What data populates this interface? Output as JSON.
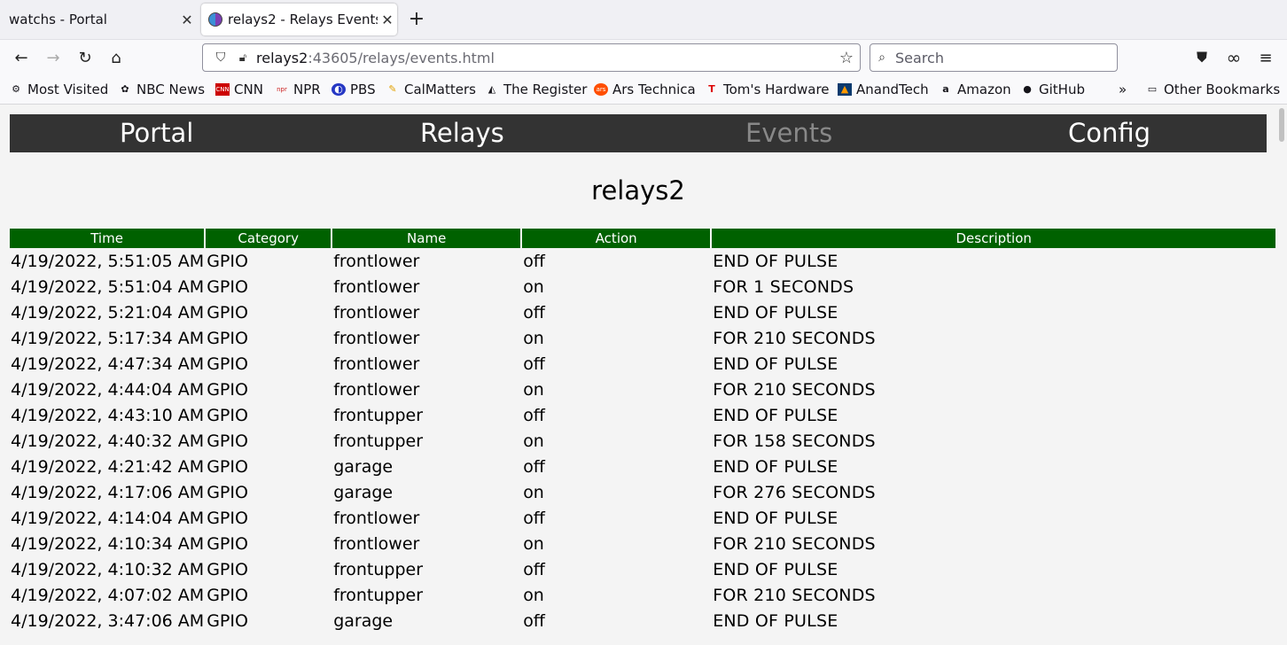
{
  "browser": {
    "tabs": [
      {
        "title": "watchs - Portal",
        "active": false
      },
      {
        "title": "relays2 - Relays Events",
        "active": true
      }
    ],
    "url_host": "relays2",
    "url_rest": ":43605/relays/events.html",
    "search_placeholder": "Search",
    "bookmarks": [
      {
        "label": "Most Visited",
        "icon": "gear-icon"
      },
      {
        "label": "NBC News",
        "icon": "nbc-peacock-icon"
      },
      {
        "label": "CNN",
        "icon": "cnn-icon"
      },
      {
        "label": "NPR",
        "icon": "npr-icon"
      },
      {
        "label": "PBS",
        "icon": "pbs-icon"
      },
      {
        "label": "CalMatters",
        "icon": "calmatters-icon"
      },
      {
        "label": "The Register",
        "icon": "register-icon"
      },
      {
        "label": "Ars Technica",
        "icon": "ars-icon"
      },
      {
        "label": "Tom's Hardware",
        "icon": "toms-hardware-icon"
      },
      {
        "label": "AnandTech",
        "icon": "anandtech-icon"
      },
      {
        "label": "Amazon",
        "icon": "amazon-icon"
      },
      {
        "label": "GitHub",
        "icon": "github-icon"
      }
    ],
    "other_bookmarks": "Other Bookmarks"
  },
  "nav": [
    "Portal",
    "Relays",
    "Events",
    "Config"
  ],
  "current_nav": "Events",
  "page_title": "relays2",
  "table": {
    "headers": [
      "Time",
      "Category",
      "Name",
      "Action",
      "Description"
    ],
    "rows": [
      [
        "4/19/2022, 5:51:05 AM",
        "GPIO",
        "frontlower",
        "off",
        "END OF PULSE"
      ],
      [
        "4/19/2022, 5:51:04 AM",
        "GPIO",
        "frontlower",
        "on",
        "FOR 1 SECONDS"
      ],
      [
        "4/19/2022, 5:21:04 AM",
        "GPIO",
        "frontlower",
        "off",
        "END OF PULSE"
      ],
      [
        "4/19/2022, 5:17:34 AM",
        "GPIO",
        "frontlower",
        "on",
        "FOR 210 SECONDS"
      ],
      [
        "4/19/2022, 4:47:34 AM",
        "GPIO",
        "frontlower",
        "off",
        "END OF PULSE"
      ],
      [
        "4/19/2022, 4:44:04 AM",
        "GPIO",
        "frontlower",
        "on",
        "FOR 210 SECONDS"
      ],
      [
        "4/19/2022, 4:43:10 AM",
        "GPIO",
        "frontupper",
        "off",
        "END OF PULSE"
      ],
      [
        "4/19/2022, 4:40:32 AM",
        "GPIO",
        "frontupper",
        "on",
        "FOR 158 SECONDS"
      ],
      [
        "4/19/2022, 4:21:42 AM",
        "GPIO",
        "garage",
        "off",
        "END OF PULSE"
      ],
      [
        "4/19/2022, 4:17:06 AM",
        "GPIO",
        "garage",
        "on",
        "FOR 276 SECONDS"
      ],
      [
        "4/19/2022, 4:14:04 AM",
        "GPIO",
        "frontlower",
        "off",
        "END OF PULSE"
      ],
      [
        "4/19/2022, 4:10:34 AM",
        "GPIO",
        "frontlower",
        "on",
        "FOR 210 SECONDS"
      ],
      [
        "4/19/2022, 4:10:32 AM",
        "GPIO",
        "frontupper",
        "off",
        "END OF PULSE"
      ],
      [
        "4/19/2022, 4:07:02 AM",
        "GPIO",
        "frontupper",
        "on",
        "FOR 210 SECONDS"
      ],
      [
        "4/19/2022, 3:47:06 AM",
        "GPIO",
        "garage",
        "off",
        "END OF PULSE"
      ]
    ]
  },
  "colors": {
    "nav_background": "#333333",
    "table_header": "#006100",
    "current_nav_text": "#888888"
  }
}
